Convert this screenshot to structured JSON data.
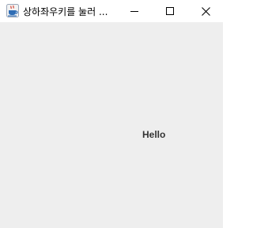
{
  "window": {
    "title": "상하좌우키를 눌러 ...",
    "app_icon": "java-coffee-cup-icon",
    "controls": {
      "minimize_icon": "minimize-icon",
      "maximize_icon": "maximize-icon",
      "close_icon": "close-icon"
    }
  },
  "content": {
    "label": "Hello",
    "background": "#eeeeee",
    "label_color": "#333333"
  }
}
